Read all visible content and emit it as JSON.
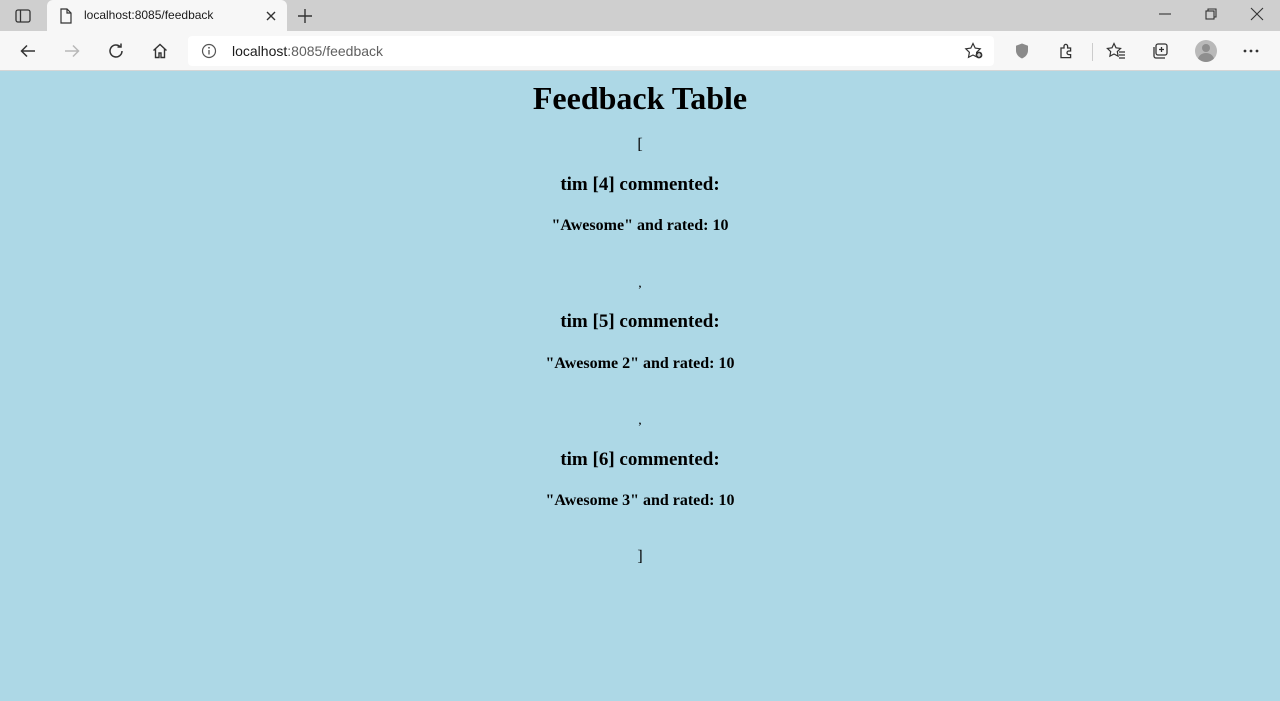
{
  "browser": {
    "tab_title": "localhost:8085/feedback",
    "url_host": "localhost",
    "url_rest": ":8085/feedback"
  },
  "page": {
    "heading": "Feedback Table",
    "open_bracket": "[",
    "close_bracket": "]",
    "separator": ",",
    "entries": [
      {
        "commenter": "tim [4] commented:",
        "comment": "\"Awesome\" and rated: 10"
      },
      {
        "commenter": "tim [5] commented:",
        "comment": "\"Awesome 2\" and rated: 10"
      },
      {
        "commenter": "tim [6] commented:",
        "comment": "\"Awesome 3\" and rated: 10"
      }
    ]
  },
  "icons": {
    "tab_actions": "tab-actions-icon",
    "page": "page-icon",
    "close": "close-icon",
    "new_tab": "plus-icon",
    "minimize": "minimize-icon",
    "restore": "restore-icon",
    "window_close": "window-close-icon",
    "back": "back-icon",
    "forward": "forward-icon",
    "refresh": "refresh-icon",
    "home": "home-icon",
    "info": "info-icon",
    "add_favorite": "add-favorite-icon",
    "tracking": "shield-icon",
    "extensions": "puzzle-icon",
    "favorites": "favorites-icon",
    "collections": "collections-icon",
    "profile": "profile-icon",
    "menu": "more-icon"
  }
}
